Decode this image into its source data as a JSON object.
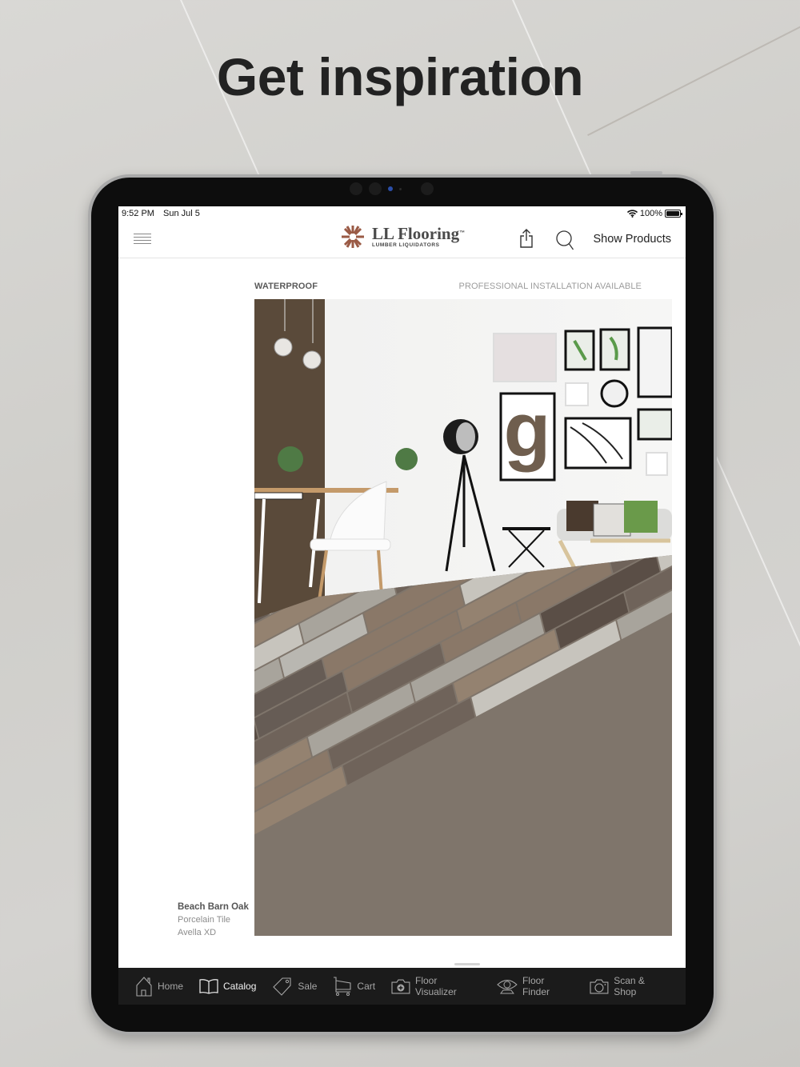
{
  "headline": "Get inspiration",
  "status_bar": {
    "time": "9:52 PM",
    "date": "Sun Jul 5",
    "battery": "100%",
    "battery_level": 1.0
  },
  "nav_bar": {
    "logo": {
      "name": "LL Flooring",
      "trademark": "™",
      "subtitle": "LUMBER LIQUIDATORS",
      "brand_color": "#9a5a45"
    },
    "share_icon": "share-icon",
    "search_icon": "search-icon",
    "show_products_label": "Show Products"
  },
  "catalog_page": {
    "label_left": "WATERPROOF",
    "label_right": "PROFESSIONAL INSTALLATION AVAILABLE",
    "photo_description": "Living room with distressed multi-tone wood-look porcelain tile floor, white dining chairs, tripod floor lamp, gallery wall and sofa",
    "product": {
      "name": "Beach Barn Oak",
      "type": "Porcelain Tile",
      "collection": "Avella XD"
    }
  },
  "tab_bar": {
    "active": "Catalog",
    "items": [
      {
        "label": "Home",
        "icon": "home-icon"
      },
      {
        "label": "Catalog",
        "icon": "book-icon"
      },
      {
        "label": "Sale",
        "icon": "tag-icon"
      },
      {
        "label": "Cart",
        "icon": "cart-icon"
      },
      {
        "label": "Floor Visualizer",
        "icon": "camera-plus-icon"
      },
      {
        "label": "Floor Finder",
        "icon": "eye-icon"
      },
      {
        "label": "Scan & Shop",
        "icon": "camera-icon"
      }
    ]
  }
}
